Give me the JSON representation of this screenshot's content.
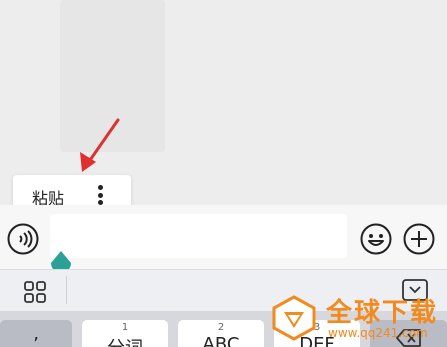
{
  "popup": {
    "paste_label": "粘贴"
  },
  "toolbar": {},
  "keyboard": {
    "keys": [
      {
        "num": "",
        "main": "’"
      },
      {
        "num": "1",
        "main": "分词"
      },
      {
        "num": "2",
        "main": "ABC"
      },
      {
        "num": "3",
        "main": "DEF"
      }
    ]
  },
  "watermark": {
    "text": "全球下载",
    "url": "www.qq241.com"
  },
  "colors": {
    "accent": "#2aa198",
    "arrow": "#e03030",
    "watermark": "#f28a1e"
  },
  "icons": [
    "more-vertical-icon",
    "voice-icon",
    "emoji-icon",
    "plus-icon",
    "grid-icon",
    "keyboard-collapse-icon",
    "delete-icon"
  ]
}
